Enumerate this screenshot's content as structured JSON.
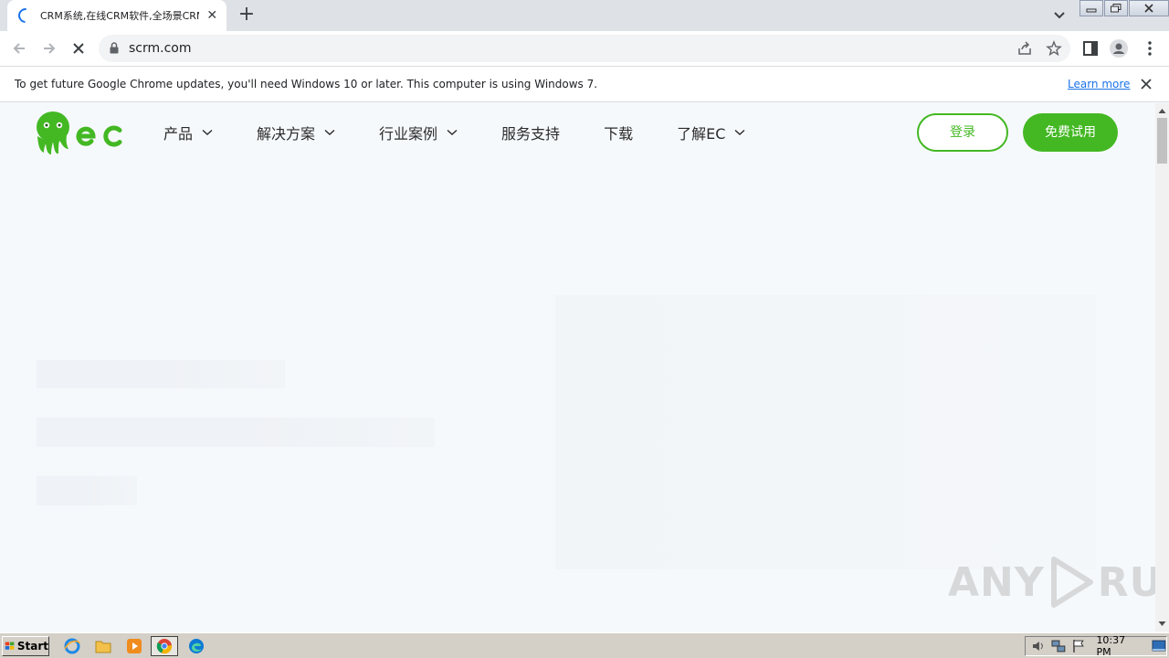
{
  "tab": {
    "title": "CRM系统,在线CRM软件,全场景CRM"
  },
  "toolbar": {
    "url": "scrm.com"
  },
  "infobar": {
    "message": "To get future Google Chrome updates, you'll need Windows 10 or later. This computer is using Windows 7.",
    "link": "Learn more"
  },
  "site": {
    "nav": [
      {
        "label": "产品",
        "dropdown": true
      },
      {
        "label": "解决方案",
        "dropdown": true
      },
      {
        "label": "行业案例",
        "dropdown": true
      },
      {
        "label": "服务支持",
        "dropdown": false
      },
      {
        "label": "下载",
        "dropdown": false
      },
      {
        "label": "了解EC",
        "dropdown": true
      }
    ],
    "login": "登录",
    "trial": "免费试用"
  },
  "watermark": {
    "left": "ANY",
    "right": "RUN"
  },
  "taskbar": {
    "start": "Start",
    "clock": "10:37 PM"
  },
  "colors": {
    "brand_green": "#43b823",
    "chrome_blue": "#1a73e8",
    "page_bg": "#f6f9fc"
  }
}
